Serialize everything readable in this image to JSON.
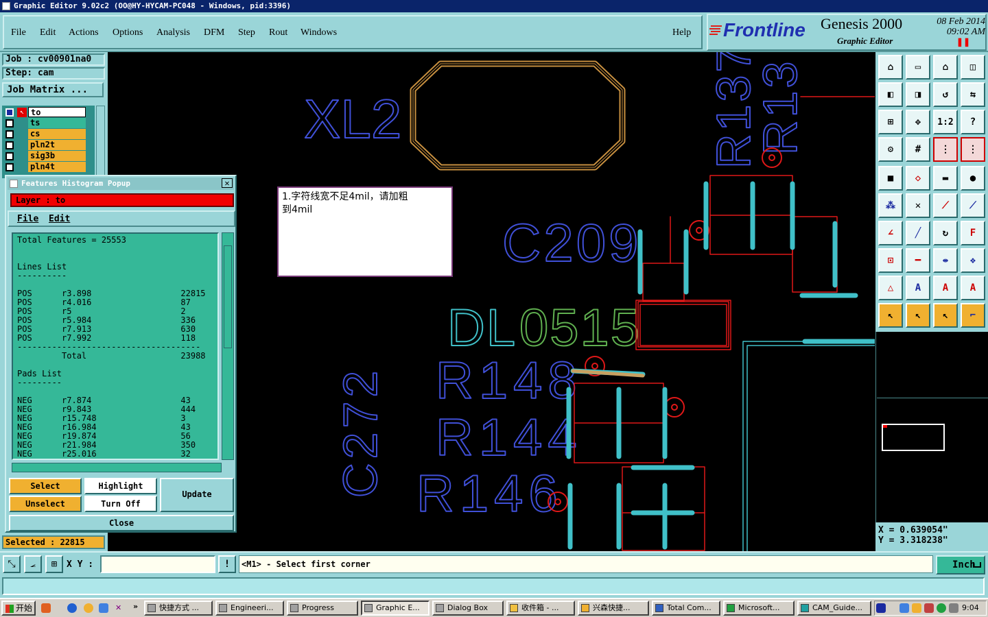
{
  "window": {
    "title": "Graphic Editor 9.02c2 (OO@HY-HYCAM-PC048 - Windows, pid:3396)"
  },
  "menu": {
    "items": [
      "File",
      "Edit",
      "Actions",
      "Options",
      "Analysis",
      "DFM",
      "Step",
      "Rout",
      "Windows"
    ],
    "help": "Help"
  },
  "brand": {
    "logo": "Frontline",
    "product": "Genesis 2000",
    "subtitle": "Graphic Editor",
    "date": "08 Feb 2014",
    "time": "09:02  AM"
  },
  "job": {
    "job": "Job : cv00901na0",
    "step": "Step: cam",
    "matrix_button": "Job Matrix ..."
  },
  "layers": [
    {
      "name": "to",
      "color": "#ffffff"
    },
    {
      "name": "ts",
      "color": "#35b898"
    },
    {
      "name": "cs",
      "color": "#f0b030"
    },
    {
      "name": "pln2t",
      "color": "#f0b030"
    },
    {
      "name": "sig3b",
      "color": "#f0b030"
    },
    {
      "name": "pln4t",
      "color": "#f0b030"
    }
  ],
  "popup": {
    "title": "Features Histogram Popup",
    "layer": "Layer :  to",
    "menu": [
      "File",
      "Edit"
    ],
    "text": "Total Features = 25553\n\n\nLines List\n----------\n\nPOS      r3.898                  22815\nPOS      r4.016                  87\nPOS      r5                      2\nPOS      r5.984                  336\nPOS      r7.913                  630\nPOS      r7.992                  118\n-------------------------------------\n         Total                   23988\n\nPads List\n---------\n\nNEG      r7.874                  43\nNEG      r9.843                  444\nNEG      r15.748                 3\nNEG      r16.984                 43\nNEG      r19.874                 56\nNEG      r21.984                 350\nNEG      r25.016                 32",
    "buttons": {
      "select": "Select",
      "highlight": "Highlight",
      "update": "Update",
      "unselect": "Unselect",
      "turn_off": "Turn Off",
      "close": "Close"
    }
  },
  "status": {
    "selected": "Selected : 22815"
  },
  "command": {
    "xy_label": "X Y :",
    "xy_value": "",
    "prompt": "<M1> - Select first corner",
    "units": "Inch"
  },
  "coords": {
    "x": "X  =  0.639054\"",
    "y": "Y  =  3.318238\""
  },
  "note": {
    "line1": "1.字符线宽不足4mil，请加粗",
    "line2": "到4mil"
  },
  "canvas_labels": [
    "XL2",
    "C209",
    "DL0515",
    "R148",
    "R144",
    "R146",
    "C272",
    "R137",
    "R13"
  ],
  "taskbar": {
    "start": "开始",
    "tasks": [
      "快捷方式 ...",
      "Engineeri...",
      "Progress",
      "Graphic E...",
      "Dialog Box",
      "收件箱 - ...",
      "兴森快捷...",
      "Total Com...",
      "Microsoft...",
      "CAM_Guide..."
    ],
    "time": "9:04"
  }
}
